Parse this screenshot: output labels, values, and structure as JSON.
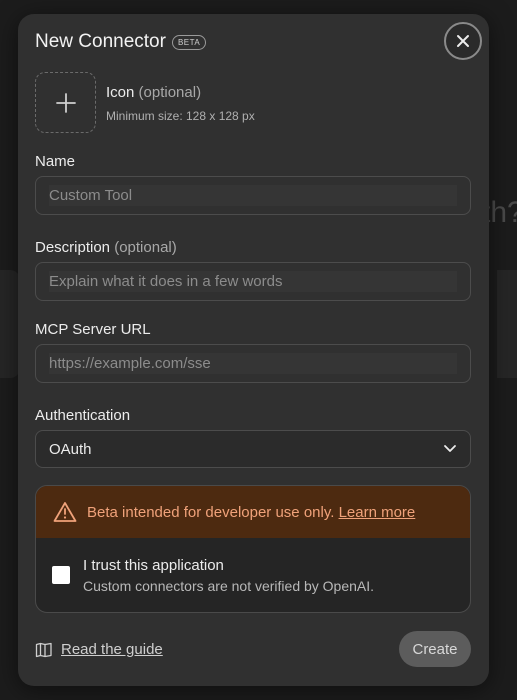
{
  "background": {
    "partial_text": "th?"
  },
  "modal": {
    "title": "New Connector",
    "badge": "BETA",
    "close_icon": "close-icon",
    "icon_field": {
      "label": "Icon",
      "optional": "(optional)",
      "hint": "Minimum size: 128 x 128 px",
      "upload_icon": "plus-icon"
    },
    "name_field": {
      "label": "Name",
      "placeholder": "Custom Tool"
    },
    "description_field": {
      "label": "Description",
      "optional": "(optional)",
      "placeholder": "Explain what it does in a few words"
    },
    "url_field": {
      "label": "MCP Server URL",
      "placeholder": "https://example.com/sse"
    },
    "auth_field": {
      "label": "Authentication",
      "value": "OAuth",
      "chevron_icon": "chevron-down-icon"
    },
    "warning": {
      "icon": "warning-triangle-icon",
      "text": "Beta intended for developer use only.",
      "link": "Learn more",
      "color": "#f0a27a"
    },
    "trust": {
      "checked": false,
      "title": "I trust this application",
      "subtitle": "Custom connectors are not verified by OpenAI."
    },
    "footer": {
      "guide_icon": "book-icon",
      "guide_label": "Read the guide",
      "create_label": "Create"
    }
  }
}
